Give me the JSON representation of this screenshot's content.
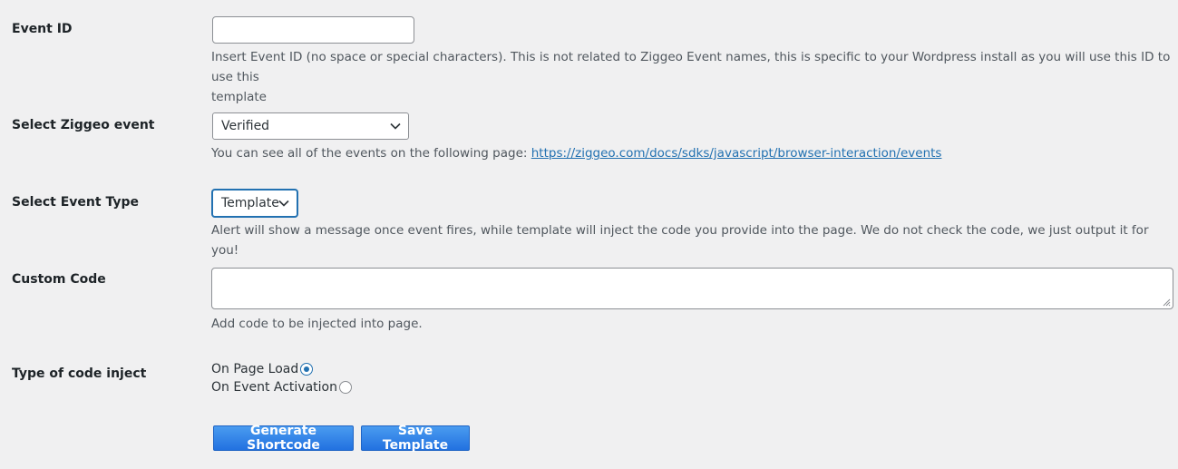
{
  "event_id": {
    "label": "Event ID",
    "value": "",
    "desc_line1": "Insert Event ID (no space or special characters). This is not related to Ziggeo Event names, this is specific to your Wordpress install as you will use this ID to use this",
    "desc_line2": "template"
  },
  "ziggeo_event": {
    "label": "Select Ziggeo event",
    "selected": "Verified",
    "desc_prefix": "You can see all of the events on the following page: ",
    "link_text": "https://ziggeo.com/docs/sdks/javascript/browser-interaction/events"
  },
  "event_type": {
    "label": "Select Event Type",
    "selected": "Template",
    "desc": "Alert will show a message once event fires, while template will inject the code you provide into the page. We do not check the code, we just output it for you!"
  },
  "custom_code": {
    "label": "Custom Code",
    "value": "",
    "desc": "Add code to be injected into page."
  },
  "code_inject": {
    "label": "Type of code inject",
    "options": [
      {
        "label": "On Page Load",
        "checked": true
      },
      {
        "label": "On Event Activation",
        "checked": false
      }
    ]
  },
  "buttons": {
    "generate": "Generate Shortcode",
    "save": "Save Template"
  },
  "colors": {
    "accent": "#2271b1",
    "background": "#f0f0f1",
    "button": "#2a7de1"
  }
}
